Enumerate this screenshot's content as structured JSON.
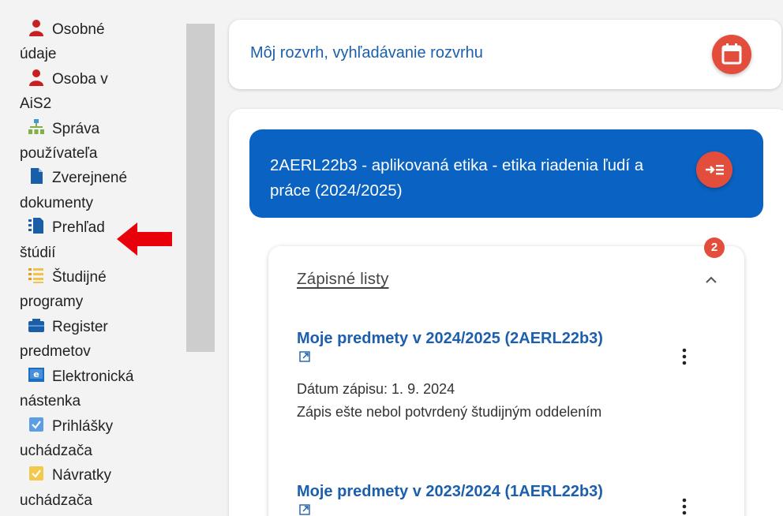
{
  "sidebar": {
    "items": [
      {
        "line1": "Osobné",
        "line2": "údaje",
        "icon": "person-icon"
      },
      {
        "line1": "Osoba v",
        "line2": "AiS2",
        "icon": "person-icon"
      },
      {
        "line1": "Správa",
        "line2": "používateľa",
        "icon": "user-management-icon"
      },
      {
        "line1": "Zverejnené",
        "line2": "dokumenty",
        "icon": "document-icon"
      },
      {
        "line1": "Prehľad",
        "line2": "štúdií",
        "icon": "study-overview-icon"
      },
      {
        "line1": "Študijné",
        "line2": "programy",
        "icon": "list-icon"
      },
      {
        "line1": "Register",
        "line2": "predmetov",
        "icon": "folder-icon"
      },
      {
        "line1": "Elektronická",
        "line2": "nástenka",
        "icon": "e-board-icon"
      },
      {
        "line1": "Prihlášky",
        "line2": "uchádzača",
        "icon": "checkbox-icon"
      },
      {
        "line1": "Návratky",
        "line2": "uchádzača",
        "icon": "checkbox-yellow-icon"
      }
    ]
  },
  "header": {
    "title": "Môj rozvrh, vyhľadávanie rozvrhu"
  },
  "banner": {
    "title": "2AERL22b3 - aplikovaná etika - etika riadenia ľudí a práce (2024/2025)"
  },
  "enrollment": {
    "badge_count": "2",
    "section_title": "Zápisné listy",
    "entries": [
      {
        "link": "Moje predmety v 2024/2025 (2AERL22b3)",
        "date": "Dátum zápisu: 1. 9. 2024",
        "status": "Zápis ešte nebol potvrdený študijným oddelením"
      },
      {
        "link": "Moje predmety v 2023/2024 (1AERL22b3)"
      }
    ]
  },
  "colors": {
    "accent": "#0a62c2",
    "link": "#1b5fad",
    "action": "#e34d3b",
    "arrow": "#e8000b"
  }
}
